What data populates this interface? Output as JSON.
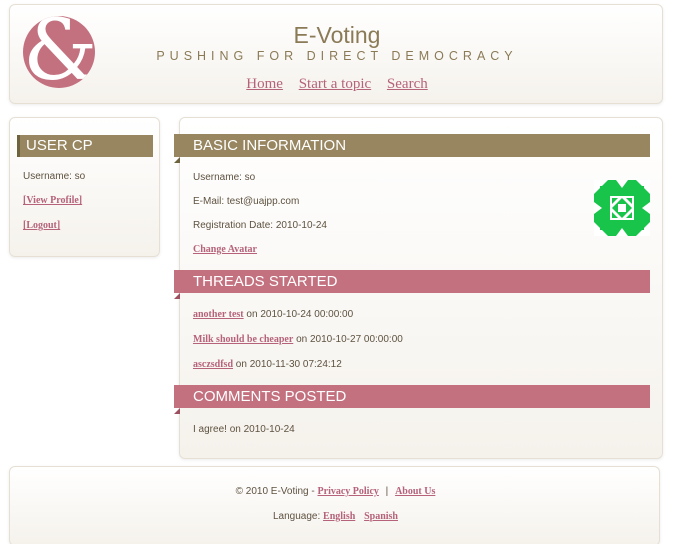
{
  "header": {
    "title": "E-Voting",
    "tagline": "PUSHING FOR DIRECT DEMOCRACY",
    "logo_glyph": "&",
    "nav": [
      "Home",
      "Start a topic",
      "Search"
    ]
  },
  "sidebar": {
    "heading": "USER CP",
    "username": "Username: so",
    "view_profile": "[View Profile]",
    "logout": "[Logout]"
  },
  "basic_info": {
    "heading": "BASIC INFORMATION",
    "username": "Username: so",
    "email": "E-Mail: test@uajpp.com",
    "registration": "Registration Date: 2010-10-24",
    "change_avatar": "Change Avatar"
  },
  "threads": {
    "heading": "THREADS STARTED",
    "items": [
      {
        "title": "another test",
        "date": " on 2010-10-24 00:00:00"
      },
      {
        "title": "Milk should be cheaper",
        "date": " on 2010-10-27 00:00:00"
      },
      {
        "title": "asczsdfsd",
        "date": " on 2010-11-30 07:24:12"
      }
    ]
  },
  "comments": {
    "heading": "COMMENTS POSTED",
    "items": [
      "I agree! on 2010-10-24"
    ]
  },
  "footer": {
    "copyright": "© 2010 E-Voting - ",
    "privacy": "Privacy Policy",
    "separator": "|",
    "about": "About Us",
    "language_label": "Language: ",
    "english": "English",
    "spanish": "Spanish"
  },
  "colors": {
    "olive": "#978660",
    "rose": "#c3707f",
    "link": "#b5627a",
    "avatar_green": "#18c44a"
  }
}
